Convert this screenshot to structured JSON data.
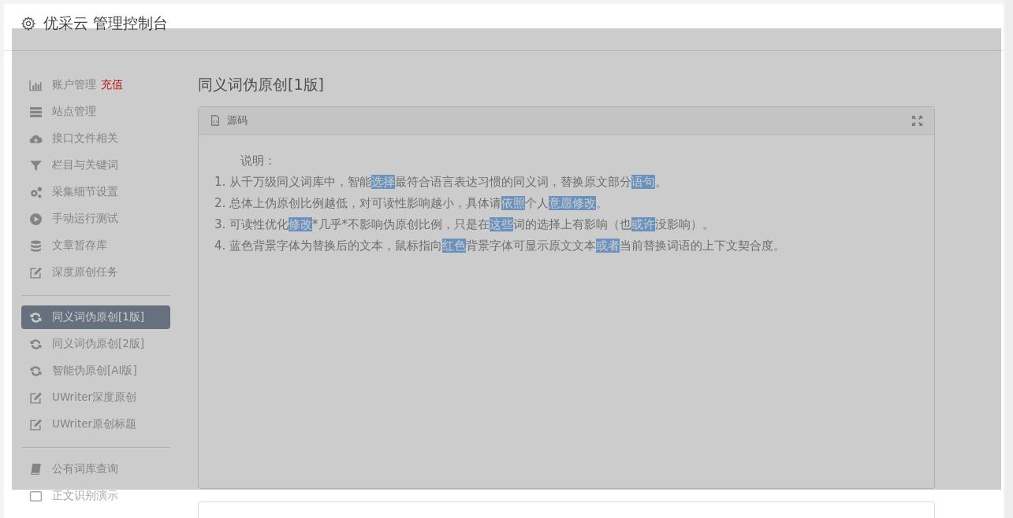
{
  "header": {
    "title": "优采云 管理控制台"
  },
  "sidebar": {
    "groups": [
      {
        "items": [
          {
            "label": "账户管理",
            "badge": "充值",
            "selected": false
          },
          {
            "label": "站点管理",
            "selected": false
          },
          {
            "label": "接口文件相关",
            "selected": false
          },
          {
            "label": "栏目与关键词",
            "selected": false
          },
          {
            "label": "采集细节设置",
            "selected": false
          },
          {
            "label": "手动运行测试",
            "selected": false
          },
          {
            "label": "文章暂存库",
            "selected": false
          },
          {
            "label": "深度原创任务",
            "selected": false
          }
        ]
      },
      {
        "items": [
          {
            "label": "同义词伪原创[1版]",
            "selected": true
          },
          {
            "label": "同义词伪原创[2版]",
            "selected": false
          },
          {
            "label": "智能伪原创[AI版]",
            "selected": false
          },
          {
            "label": "UWriter深度原创",
            "selected": false
          },
          {
            "label": "UWriter原创标题",
            "selected": false
          }
        ]
      },
      {
        "items": [
          {
            "label": "公有词库查询",
            "selected": false
          },
          {
            "label": "正文识别演示",
            "selected": false
          }
        ]
      }
    ]
  },
  "main": {
    "title": "同义词伪原创[1版]",
    "panel": {
      "title": "源码",
      "intro": "说明：",
      "lines": [
        [
          {
            "text": "1. 从千万级同义词库中，智能",
            "highlight": false
          },
          {
            "text": "选择",
            "highlight": true
          },
          {
            "text": "最符合语言表达习惯的同义词，替换原文部分",
            "highlight": false
          },
          {
            "text": "语句",
            "highlight": true
          },
          {
            "text": "。",
            "highlight": false
          }
        ],
        [
          {
            "text": "2. 总体上伪原创比例越低，对可读性影响越小，具体请",
            "highlight": false
          },
          {
            "text": "依照",
            "highlight": true
          },
          {
            "text": "个人",
            "highlight": false
          },
          {
            "text": "意愿",
            "highlight": true
          },
          {
            "text": "修改",
            "highlight": true
          },
          {
            "text": "。",
            "highlight": false
          }
        ],
        [
          {
            "text": "3. 可读性优化",
            "highlight": false
          },
          {
            "text": "修改",
            "highlight": true
          },
          {
            "text": "*几乎*不影响伪原创比例，只是在",
            "highlight": false
          },
          {
            "text": "这些",
            "highlight": true
          },
          {
            "text": "词的选择上有影响（也",
            "highlight": false
          },
          {
            "text": "或许",
            "highlight": true
          },
          {
            "text": "没影响）。",
            "highlight": false
          }
        ],
        [
          {
            "text": "4. 蓝色背景字体为替换后的文本，鼠标指向",
            "highlight": false
          },
          {
            "text": "红色",
            "highlight": true
          },
          {
            "text": "背景字体可显示原文文本",
            "highlight": false
          },
          {
            "text": "或者",
            "highlight": true
          },
          {
            "text": "当前替换词语的上下文契合度。",
            "highlight": false
          }
        ]
      ]
    }
  }
}
